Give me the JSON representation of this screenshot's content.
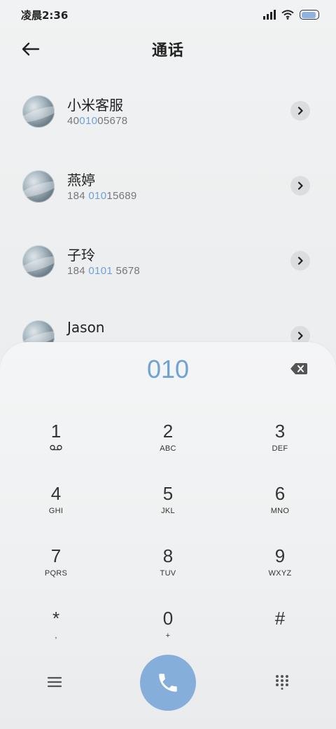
{
  "status_bar": {
    "time": "凌晨2:36",
    "battery_level": 0.9
  },
  "header": {
    "title": "通话"
  },
  "contacts": [
    {
      "name": "小米客服",
      "number_parts": [
        "40",
        "010",
        "05678"
      ]
    },
    {
      "name": "燕婷",
      "number_parts": [
        "184 ",
        "010",
        "15689"
      ]
    },
    {
      "name": "子玲",
      "number_parts": [
        "184 ",
        "0101",
        " 5678"
      ]
    },
    {
      "name": "Jason",
      "number_parts": [
        "",
        "",
        ""
      ]
    }
  ],
  "dialpad": {
    "input": "010",
    "keys": [
      {
        "digit": "1",
        "letters": ""
      },
      {
        "digit": "2",
        "letters": "ABC"
      },
      {
        "digit": "3",
        "letters": "DEF"
      },
      {
        "digit": "4",
        "letters": "GHI"
      },
      {
        "digit": "5",
        "letters": "JKL"
      },
      {
        "digit": "6",
        "letters": "MNO"
      },
      {
        "digit": "7",
        "letters": "PQRS"
      },
      {
        "digit": "8",
        "letters": "TUV"
      },
      {
        "digit": "9",
        "letters": "WXYZ"
      },
      {
        "digit": "*",
        "letters": ","
      },
      {
        "digit": "0",
        "letters": "+"
      },
      {
        "digit": "#",
        "letters": ""
      }
    ]
  },
  "icons": {
    "back": "back-arrow-icon",
    "chevron": "chevron-right-icon",
    "backspace": "backspace-icon",
    "voicemail": "voicemail-icon",
    "menu": "menu-icon",
    "call": "phone-icon",
    "keypad": "keypad-icon"
  },
  "colors": {
    "accent": "#6ea1d6",
    "call_button": "#85aedb"
  }
}
